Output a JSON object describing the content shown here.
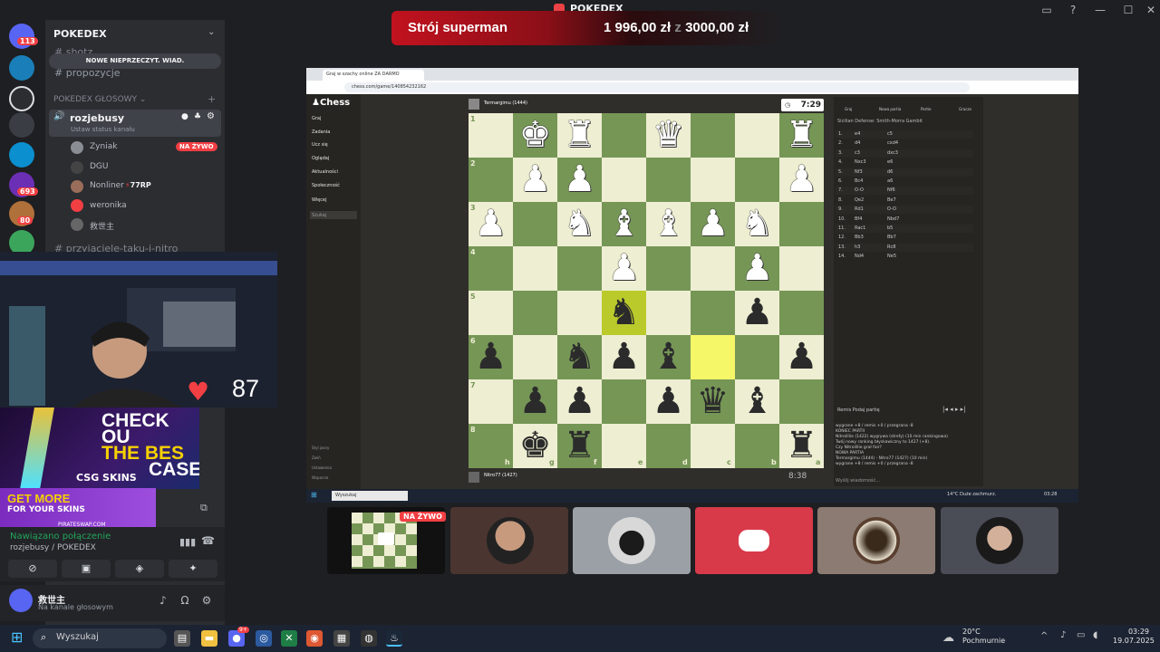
{
  "window": {
    "title": "POKEDEX"
  },
  "donation": {
    "name": "Strój superman",
    "current": "1 996,00 zł",
    "sep": "z",
    "goal": "3000,00 zł"
  },
  "rail": {
    "badges": [
      "113",
      "693",
      "80"
    ]
  },
  "server": {
    "name": "POKEDEX",
    "channels": [
      "shotz",
      "propozycje"
    ],
    "new_messages": "NOWE NIEPRZECZYT. WIAD.",
    "voice_category": "POKEDEX GŁOSOWY",
    "active_voice": "rozjebusy",
    "voice_status": "Ustaw status kanału",
    "users": [
      "Zyniak",
      "DGU",
      "Nonliner",
      "weronika",
      "救世主"
    ],
    "nonliner_tag": "77RP",
    "live_label": "NA ŻYWO",
    "next_channel": "przyjaciele-taku-i-nitro"
  },
  "heart_rate": "87",
  "ad": {
    "line1": "CHECK OU",
    "line2": "THE BES",
    "line3": "CASE",
    "brand": "CSG SKINS",
    "get_more": "GET MORE",
    "for_skins": "FOR YOUR SKINS",
    "pirate": "PIRATESWAP.COM"
  },
  "voice": {
    "status": "Nawiązano połączenie",
    "location": "rozjebusy / POKEDEX"
  },
  "me": {
    "name": "救世主",
    "status": "Na kanale głosowym"
  },
  "browser": {
    "tab": "Graj w szachy online ZA DARMO",
    "url": "chess.com/game/140854232162",
    "nav": [
      "Graj",
      "Zadania",
      "Ucz się",
      "Oglądaj",
      "Aktualności",
      "Społeczność",
      "Więcej"
    ],
    "search": "Szukaj",
    "footer_nav": [
      "Styl jasny",
      "Zwiń",
      "Ustawienia",
      "Wsparcie"
    ],
    "top_player": "Termargimu (1444)",
    "bottom_player": "Nitro77 (1427)",
    "top_clock": "7:29",
    "bottom_clock": "8:38",
    "right_tabs": [
      "Graj",
      "Nowa partia",
      "Partie",
      "Gracze"
    ],
    "opening": "Sicilian Defense: Smith-Morra Gambit",
    "moves": [
      [
        "1.",
        "e4",
        "c5"
      ],
      [
        "2.",
        "d4",
        "cxd4"
      ],
      [
        "3.",
        "c3",
        "dxc3"
      ],
      [
        "4.",
        "Nxc3",
        "e6"
      ],
      [
        "5.",
        "Nf3",
        "d6"
      ],
      [
        "6.",
        "Bc4",
        "a6"
      ],
      [
        "7.",
        "O-O",
        "Nf6"
      ],
      [
        "8.",
        "Qe2",
        "Be7"
      ],
      [
        "9.",
        "Rd1",
        "O-O"
      ],
      [
        "10.",
        "Bf4",
        "Nbd7"
      ],
      [
        "11.",
        "Rac1",
        "b5"
      ],
      [
        "12.",
        "Bb3",
        "Bb7"
      ],
      [
        "13.",
        "h3",
        "Rc8"
      ],
      [
        "14.",
        "Nd4",
        "Ne5"
      ]
    ],
    "chat_tabs": [
      "Remis",
      "Podaj partię"
    ],
    "chat_lines": [
      "wygrane +8 / remis +0 / przegrana -8",
      "KONIEC PARTII",
      "Nitrolillie (1422) wygrywa (strefy) (10 min rankingowa)",
      "Twój nowy ranking błyskawiczny to 1427 (+8).",
      "Czy Nitrolillie grał fair?",
      "NOWA PARTIA",
      "Termargimu (1444) - Nitro77 (1427) (10 min)",
      "wygrane +8 / remis +0 / przegrana -8"
    ],
    "send_placeholder": "Wyślij wiadomość...",
    "taskbar_search": "Wyszukaj",
    "taskbar_weather": "14°C  Duże zachmurz.",
    "taskbar_clock": "03:28"
  },
  "tiles": {
    "live": "NA ŻYWO"
  },
  "taskbar": {
    "search": "Wyszukaj",
    "badge": "9+",
    "weather_temp": "20°C",
    "weather_desc": "Pochmurnie",
    "time": "03:29",
    "date": "19.07.2025"
  },
  "colors": {
    "accent_red": "#f23f43",
    "discord_blurple": "#5865f2",
    "chess_dark": "#769656",
    "chess_light": "#eeeed2",
    "online_green": "#23a55a"
  }
}
